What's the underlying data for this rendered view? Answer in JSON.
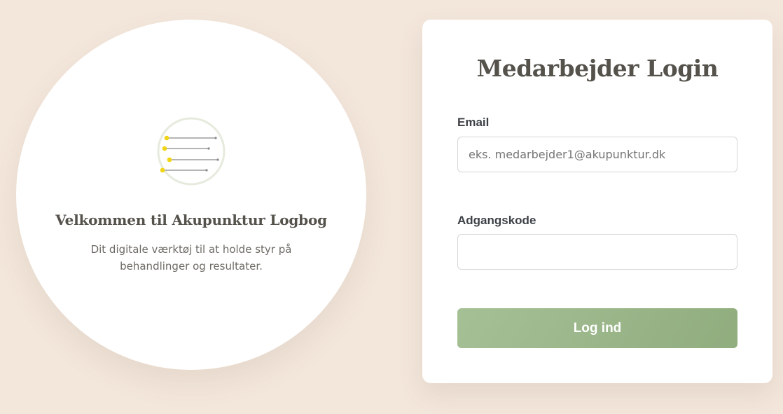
{
  "welcome": {
    "logo_icon": "acupuncture-needles-icon",
    "title": "Velkommen til Akupunktur Logbog",
    "subtitle": "Dit digitale værktøj til at holde styr på behandlinger og resultater."
  },
  "login": {
    "title": "Medarbejder Login",
    "email_label": "Email",
    "email_placeholder": "eks. medarbejder1@akupunktur.dk",
    "email_value": "",
    "password_label": "Adgangskode",
    "password_placeholder": "",
    "password_value": "",
    "submit_label": "Log ind"
  },
  "colors": {
    "background": "#f3e6db",
    "accent": "#9db78c",
    "needle_head": "#f2d417",
    "text_dark": "#55524c"
  }
}
